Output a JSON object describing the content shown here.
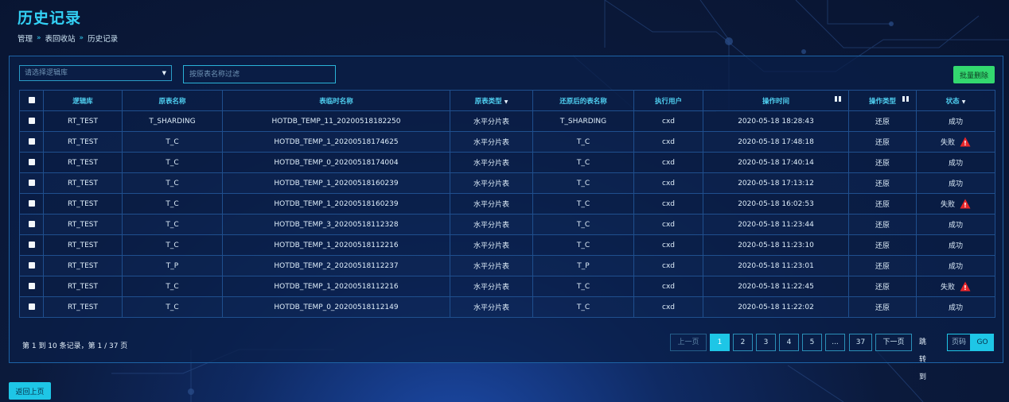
{
  "header": {
    "title": "历史记录",
    "breadcrumb": [
      "管理",
      "表回收站",
      "历史记录"
    ]
  },
  "toolbar": {
    "select_placeholder": "请选择逻辑库",
    "filter_placeholder": "按原表名称过滤",
    "batch_delete_label": "批量删除"
  },
  "table": {
    "headers": {
      "logical_db": "逻辑库",
      "original_table": "原表名称",
      "temp_table": "表临时名称",
      "original_type": "原表类型",
      "restored_table": "还原后的表名称",
      "user": "执行用户",
      "op_time": "操作时间",
      "op_type": "操作类型",
      "status": "状态"
    },
    "rows": [
      {
        "logical_db": "RT_TEST",
        "original_table": "T_SHARDING",
        "temp_table": "HOTDB_TEMP_11_20200518182250",
        "original_type": "水平分片表",
        "restored_table": "T_SHARDING",
        "user": "cxd",
        "op_time": "2020-05-18 18:28:43",
        "op_type": "还原",
        "status": "成功",
        "failed": false
      },
      {
        "logical_db": "RT_TEST",
        "original_table": "T_C",
        "temp_table": "HOTDB_TEMP_1_20200518174625",
        "original_type": "水平分片表",
        "restored_table": "T_C",
        "user": "cxd",
        "op_time": "2020-05-18 17:48:18",
        "op_type": "还原",
        "status": "失败",
        "failed": true
      },
      {
        "logical_db": "RT_TEST",
        "original_table": "T_C",
        "temp_table": "HOTDB_TEMP_0_20200518174004",
        "original_type": "水平分片表",
        "restored_table": "T_C",
        "user": "cxd",
        "op_time": "2020-05-18 17:40:14",
        "op_type": "还原",
        "status": "成功",
        "failed": false
      },
      {
        "logical_db": "RT_TEST",
        "original_table": "T_C",
        "temp_table": "HOTDB_TEMP_1_20200518160239",
        "original_type": "水平分片表",
        "restored_table": "T_C",
        "user": "cxd",
        "op_time": "2020-05-18 17:13:12",
        "op_type": "还原",
        "status": "成功",
        "failed": false
      },
      {
        "logical_db": "RT_TEST",
        "original_table": "T_C",
        "temp_table": "HOTDB_TEMP_1_20200518160239",
        "original_type": "水平分片表",
        "restored_table": "T_C",
        "user": "cxd",
        "op_time": "2020-05-18 16:02:53",
        "op_type": "还原",
        "status": "失败",
        "failed": true
      },
      {
        "logical_db": "RT_TEST",
        "original_table": "T_C",
        "temp_table": "HOTDB_TEMP_3_20200518112328",
        "original_type": "水平分片表",
        "restored_table": "T_C",
        "user": "cxd",
        "op_time": "2020-05-18 11:23:44",
        "op_type": "还原",
        "status": "成功",
        "failed": false
      },
      {
        "logical_db": "RT_TEST",
        "original_table": "T_C",
        "temp_table": "HOTDB_TEMP_1_20200518112216",
        "original_type": "水平分片表",
        "restored_table": "T_C",
        "user": "cxd",
        "op_time": "2020-05-18 11:23:10",
        "op_type": "还原",
        "status": "成功",
        "failed": false
      },
      {
        "logical_db": "RT_TEST",
        "original_table": "T_P",
        "temp_table": "HOTDB_TEMP_2_20200518112237",
        "original_type": "水平分片表",
        "restored_table": "T_P",
        "user": "cxd",
        "op_time": "2020-05-18 11:23:01",
        "op_type": "还原",
        "status": "成功",
        "failed": false
      },
      {
        "logical_db": "RT_TEST",
        "original_table": "T_C",
        "temp_table": "HOTDB_TEMP_1_20200518112216",
        "original_type": "水平分片表",
        "restored_table": "T_C",
        "user": "cxd",
        "op_time": "2020-05-18 11:22:45",
        "op_type": "还原",
        "status": "失败",
        "failed": true
      },
      {
        "logical_db": "RT_TEST",
        "original_table": "T_C",
        "temp_table": "HOTDB_TEMP_0_20200518112149",
        "original_type": "水平分片表",
        "restored_table": "T_C",
        "user": "cxd",
        "op_time": "2020-05-18 11:22:02",
        "op_type": "还原",
        "status": "成功",
        "failed": false
      }
    ]
  },
  "pagination": {
    "info": "第 1 到 10 条记录，第 1 / 37 页",
    "prev_label": "上一页",
    "next_label": "下一页",
    "pages": [
      "1",
      "2",
      "3",
      "4",
      "5",
      "...",
      "37"
    ],
    "current_page": "1",
    "jump_label": "跳转到",
    "page_input_placeholder": "页码",
    "go_label": "GO"
  },
  "footer": {
    "back_label": "返回上页"
  },
  "colors": {
    "accent": "#1ec6e6",
    "success_button": "#33d86f",
    "warning": "#e8262a"
  },
  "icons": {
    "sort": "caret-down-icon",
    "column_filter": "filter-icon",
    "failure": "warning-triangle-icon",
    "breadcrumb_separator": "double-chevron-right-icon"
  }
}
